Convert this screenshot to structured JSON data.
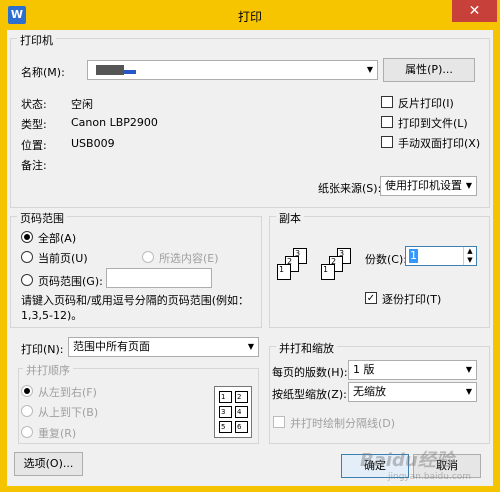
{
  "window": {
    "title": "打印",
    "app_icon": "W",
    "close_glyph": "✕"
  },
  "printer": {
    "group_label": "打印机",
    "name_label": "名称(M):",
    "properties_button": "属性(P)...",
    "status_label": "状态:",
    "status_value": "空闲",
    "type_label": "类型:",
    "type_value": "Canon LBP2900",
    "location_label": "位置:",
    "location_value": "USB009",
    "comment_label": "备注:",
    "options": [
      {
        "label": "反片打印(I)",
        "checked": false
      },
      {
        "label": "打印到文件(L)",
        "checked": false
      },
      {
        "label": "手动双面打印(X)",
        "checked": false
      }
    ],
    "paper_source_label": "纸张来源(S):",
    "paper_source_value": "使用打印机设置"
  },
  "page_range": {
    "group_label": "页码范围",
    "all": "全部(A)",
    "current": "当前页(U)",
    "selection": "所选内容(E)",
    "pages": "页码范围(G):",
    "hint": "请键入页码和/或用逗号分隔的页码范围(例如：1,3,5-12)。"
  },
  "copies": {
    "group_label": "副本",
    "count_label": "份数(C):",
    "count_value": "1",
    "collate_label": "逐份打印(T)",
    "collate_checked": true,
    "stack_pages": [
      "3",
      "2",
      "1"
    ]
  },
  "print_what": {
    "label": "打印(N):",
    "value": "范围中所有页面"
  },
  "order": {
    "group_label": "并打顺序",
    "left_to_right": "从左到右(F)",
    "top_to_bottom": "从上到下(B)",
    "repeat": "重复(R)",
    "grid": [
      "1",
      "2",
      "3",
      "4",
      "5",
      "6"
    ]
  },
  "zoom": {
    "group_label": "并打和缩放",
    "pages_per_sheet_label": "每页的版数(H):",
    "pages_per_sheet_value": "1 版",
    "scale_label": "按纸型缩放(Z):",
    "scale_value": "无缩放",
    "draw_borders_label": "并打时绘制分隔线(D)"
  },
  "footer": {
    "options_button": "选项(O)...",
    "ok_button": "确定",
    "cancel_button": "取消"
  },
  "watermark": {
    "text": "Baidu经验",
    "url": "jingyan.baidu.com"
  }
}
